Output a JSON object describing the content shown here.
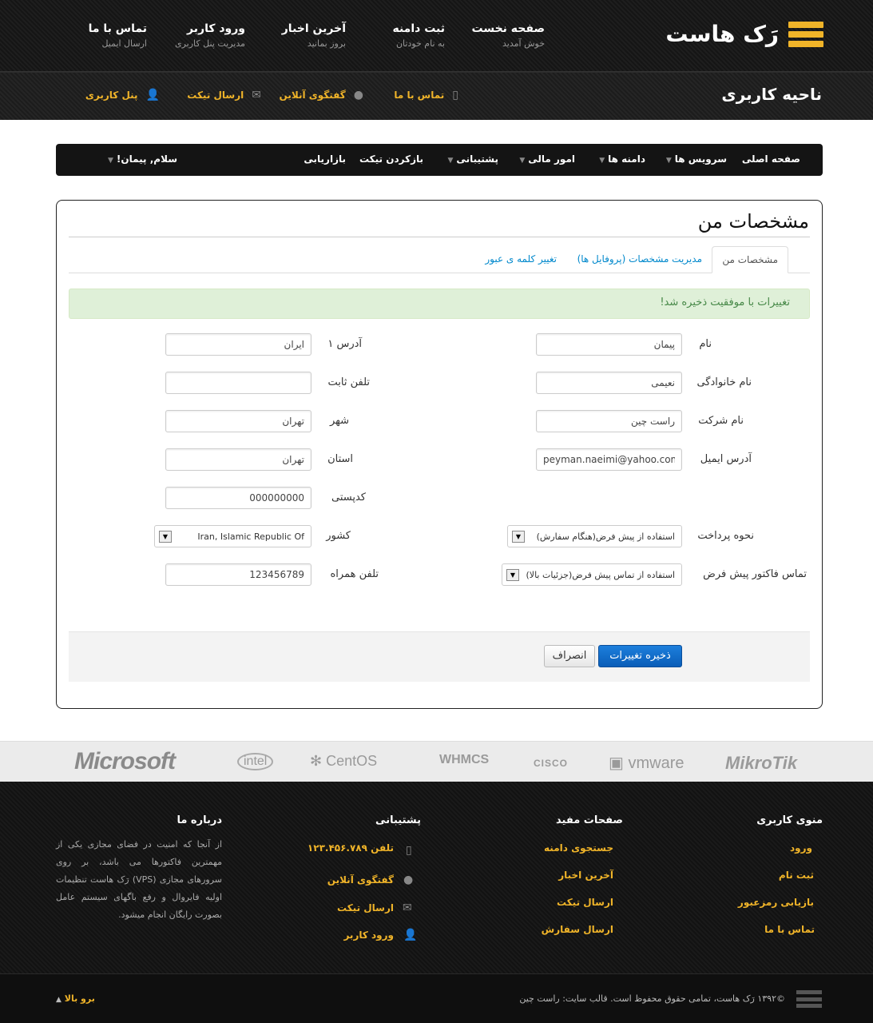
{
  "brand": {
    "name": "رَک هاست"
  },
  "top_nav": [
    {
      "title": "صفحه نخست",
      "sub": "خوش آمدید"
    },
    {
      "title": "ثبت دامنه",
      "sub": "به نام خودتان"
    },
    {
      "title": "آخرین اخبار",
      "sub": "بروز بمانید"
    },
    {
      "title": "ورود کاربر",
      "sub": "مدیریت پنل کاربری"
    },
    {
      "title": "تماس با ما",
      "sub": "ارسال ایمیل"
    }
  ],
  "subbar": {
    "title": "ناحیه کاربری",
    "links": [
      {
        "label": "تماس با ما",
        "icon": "phone-icon"
      },
      {
        "label": "گفتگوی آنلاین",
        "icon": "chat-icon"
      },
      {
        "label": "ارسال تیکت",
        "icon": "envelope-icon"
      },
      {
        "label": "پنل کاربری",
        "icon": "user-icon"
      }
    ]
  },
  "main_menu": {
    "items": [
      "صفحه اصلی",
      "سرویس ها",
      "دامنه ها",
      "امور مالی",
      "پشتیبانی",
      "بازکردن تیکت",
      "بازاریابی"
    ],
    "greeting": "سلام, پیمان!"
  },
  "page": {
    "title": "مشخصات من",
    "tabs": [
      "مشخصات من",
      "مدیریت مشخصات (پروفایل ها)",
      "تغییر کلمه ی عبور"
    ],
    "alert": "تغییرات با موفقیت ذخیره شد!",
    "right_fields": [
      {
        "label": "نام",
        "value": "پیمان"
      },
      {
        "label": "نام خانوادگی",
        "value": "نعیمی"
      },
      {
        "label": "نام شرکت",
        "value": "راست چین"
      },
      {
        "label": "آدرس ایمیل",
        "value": "peyman.naeimi@yahoo.com"
      }
    ],
    "left_fields": [
      {
        "label": "آدرس ۱",
        "value": "ایران"
      },
      {
        "label": "تلفن ثابت",
        "value": ""
      },
      {
        "label": "شهر",
        "value": "تهران"
      },
      {
        "label": "استان",
        "value": "تهران"
      },
      {
        "label": "کدپستی",
        "value": "000000000"
      }
    ],
    "payment_label": "نحوه پرداخت",
    "payment_value": "استفاده از پیش فرض(هنگام سفارش)",
    "country_label": "کشور",
    "country_value": "Iran, Islamic Republic Of",
    "invoice_contact_label": "تماس فاکتور پیش فرض",
    "invoice_contact_value": "استفاده از تماس پیش فرض(جزئیات بالا)",
    "mobile_label": "تلفن همراه",
    "mobile_value": "123456789",
    "save_label": "ذخیره تغییرات",
    "cancel_label": "انصراف"
  },
  "partner_logos": [
    "Microsoft",
    "intel",
    "CentOS",
    "WHMCS",
    "CISCO",
    "vmware",
    "MikroTik"
  ],
  "footer": {
    "user_menu": {
      "title": "منوی کاربری",
      "links": [
        "ورود",
        "ثبت نام",
        "بازیابی رمزعبور",
        "تماس با ما"
      ]
    },
    "useful": {
      "title": "صفحات مفید",
      "links": [
        "جستجوی دامنه",
        "آخرین اخبار",
        "ارسال تیکت",
        "ارسال سفارش"
      ]
    },
    "support": {
      "title": "پشتیبانی",
      "links": [
        "تلفن ۱۲۳.۴۵۶.۷۸۹",
        "گفتگوی آنلاین",
        "ارسال تیکت",
        "ورود کاربر"
      ]
    },
    "about": {
      "title": "درباره ما",
      "text": "از آنجا که امنیت در فضای مجازی یکی از مهمترین فاکتورها می باشد، بر روی سرورهای مجازی (VPS) رَک هاست تنظیمات اولیه فایروال و رفع باگهای سیستم عامل بصورت رایگان انجام میشود."
    },
    "copyright": "©۱۳۹۲ رَک هاست، تمامی حقوق محفوظ است. قالب سایت: راست چین",
    "back_to_top": "برو بالا"
  }
}
